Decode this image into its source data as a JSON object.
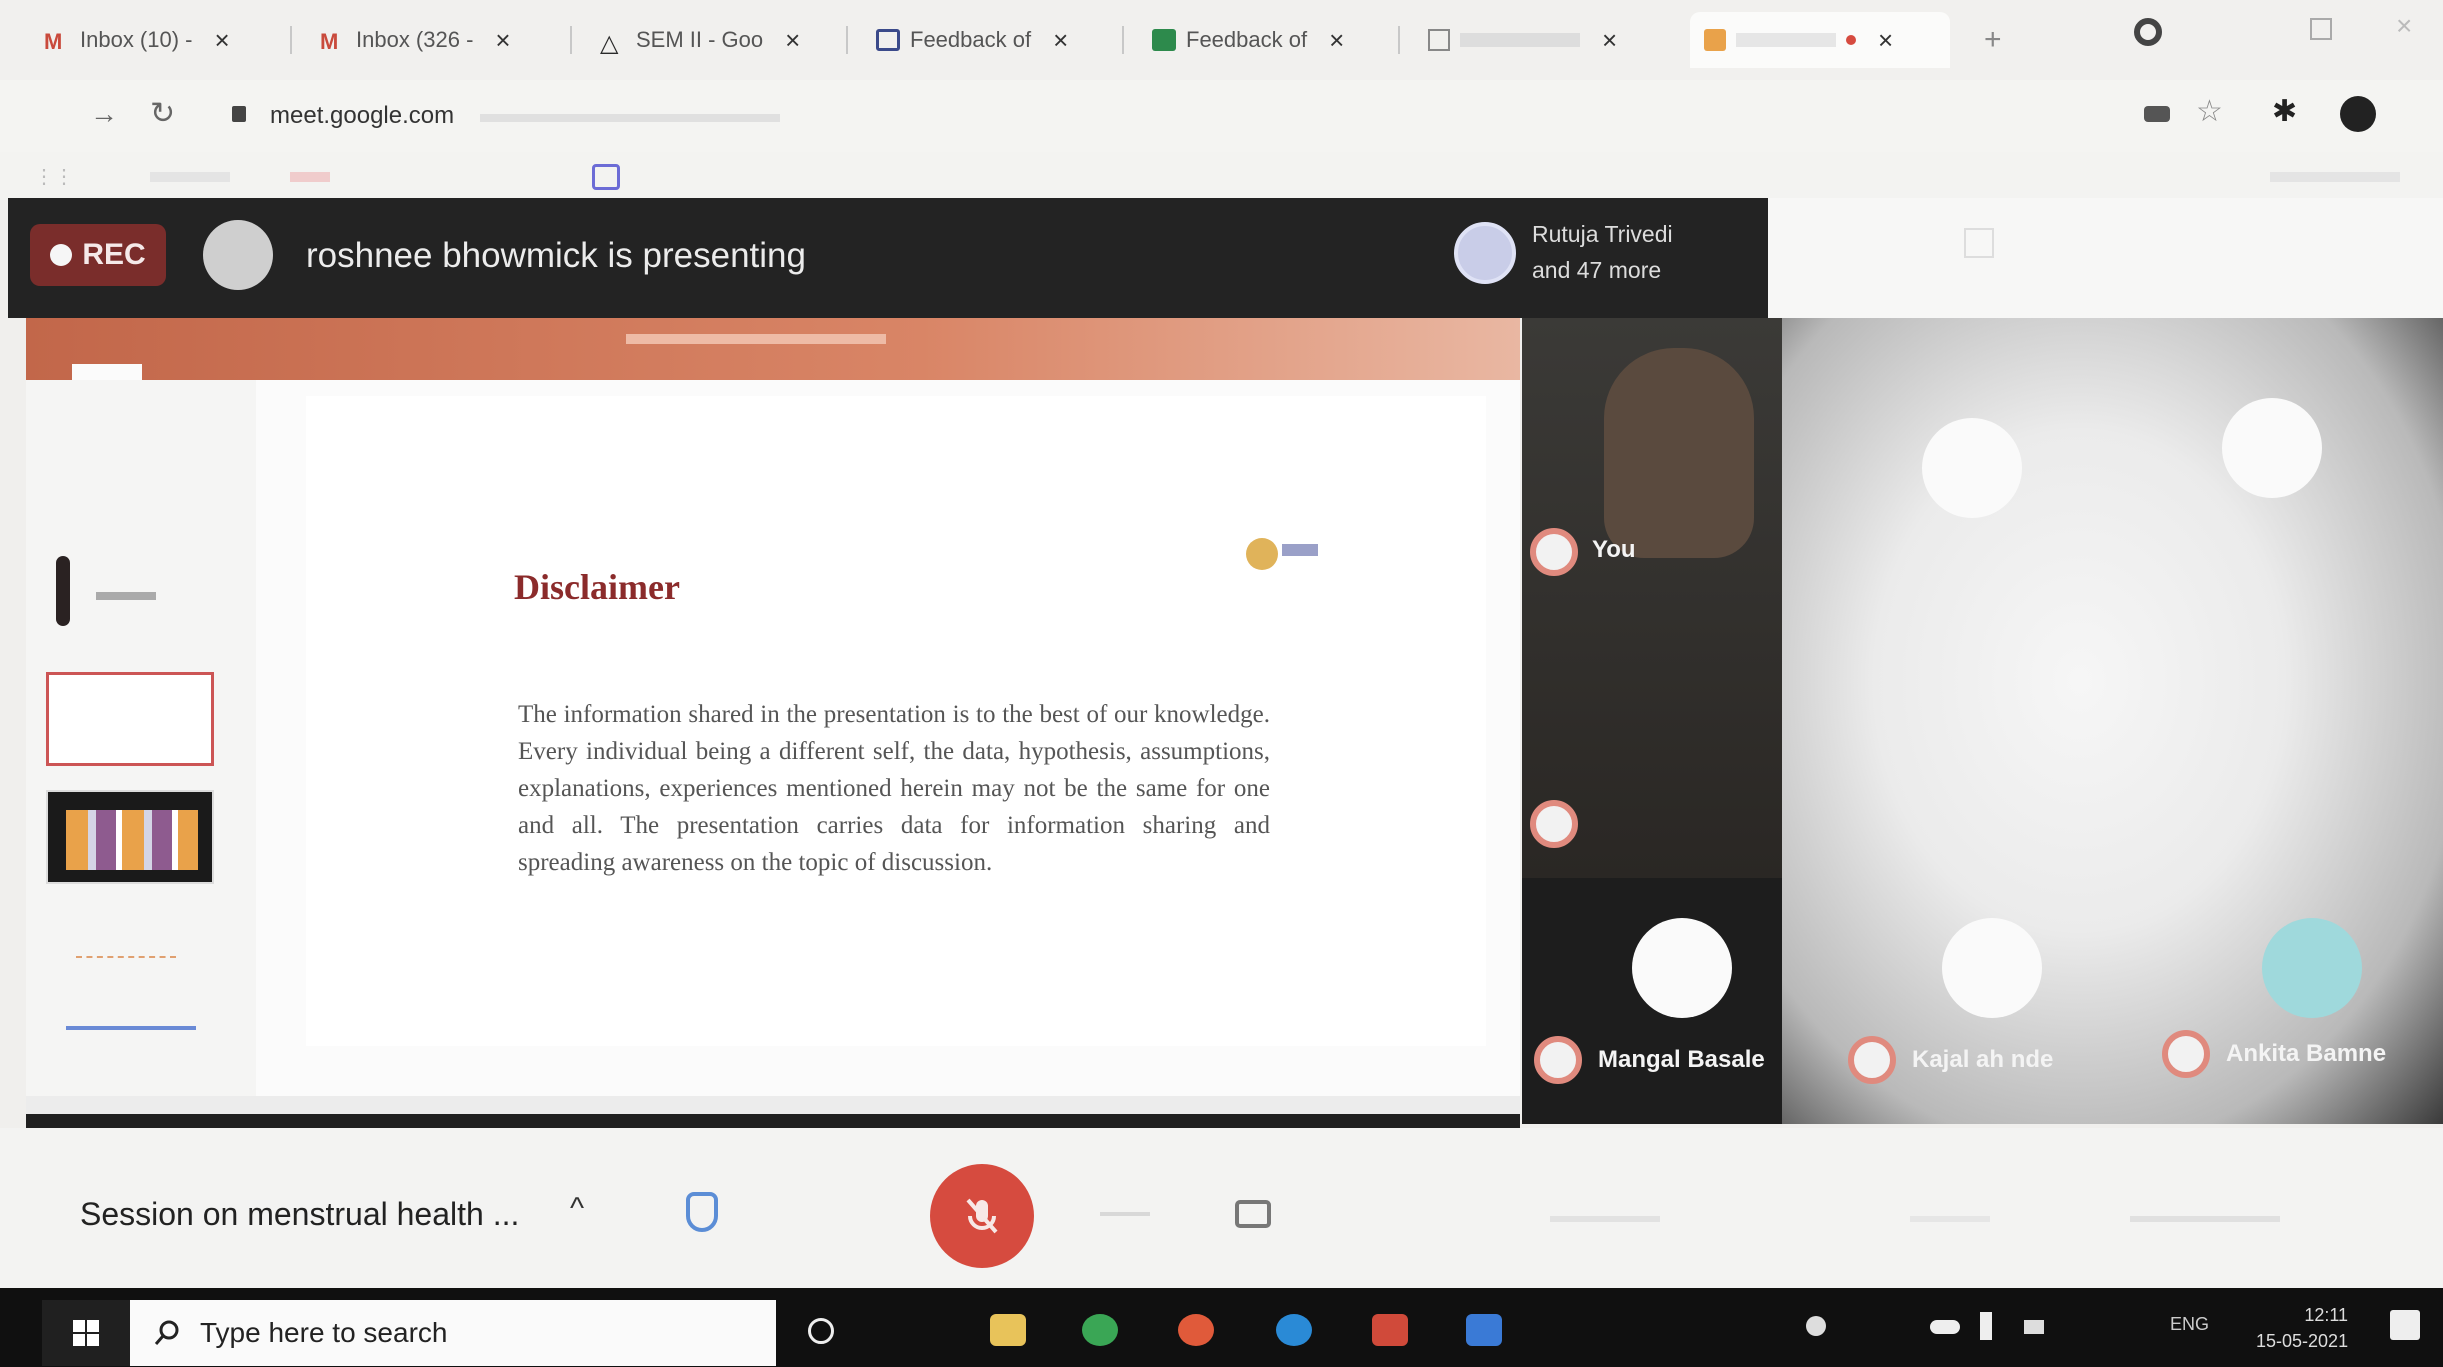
{
  "browser": {
    "tabs": [
      {
        "label": "Inbox (10) - ",
        "favicon": "gmail-icon",
        "color": "#c94a3c"
      },
      {
        "label": "Inbox (326 -",
        "favicon": "gmail-icon",
        "color": "#c94a3c"
      },
      {
        "label": "SEM II - Goo",
        "favicon": "drive-icon",
        "color": "#2a2a2a"
      },
      {
        "label": "Feedback of",
        "favicon": "forms-icon",
        "color": "#3b4a8a"
      },
      {
        "label": "Feedback of",
        "favicon": "sheets-icon",
        "color": "#2d8a4c"
      },
      {
        "label": "",
        "favicon": "page-icon",
        "color": "#888888"
      },
      {
        "label": "",
        "favicon": "meet-icon",
        "color": "#e9a24a"
      }
    ],
    "url": "meet.google.com",
    "new_tab_symbol": "+"
  },
  "meet": {
    "rec_label": "REC",
    "presenter_text": "roshnee bhowmick is presenting",
    "participants_summary": [
      "Rutuja Trivedi",
      "and 47 more"
    ],
    "participants": [
      {
        "name": "You"
      },
      {
        "name": "Mangal Basale"
      },
      {
        "name": "Kajal ah nde"
      },
      {
        "name": "Ankita Bamne"
      }
    ],
    "meeting_title": "Session on menstrual health ...",
    "chevron": "^"
  },
  "slide": {
    "title": "Disclaimer",
    "body": "The information shared in the presentation is to the best of our knowledge. Every individual being a different self, the data, hypothesis, assumptions, explanations, experiences mentioned herein may not be the same for one and all. The presentation carries data for information sharing and spreading awareness on the topic of discussion."
  },
  "taskbar": {
    "search_placeholder": "Type here to search",
    "language": "ENG",
    "time": "12:11",
    "date": "15-05-2021"
  },
  "colors": {
    "rec": "#7a2d2b",
    "mic_off": "#d64b3f",
    "slide_title": "#8b2b2b",
    "ribbon": "#c2674a"
  }
}
